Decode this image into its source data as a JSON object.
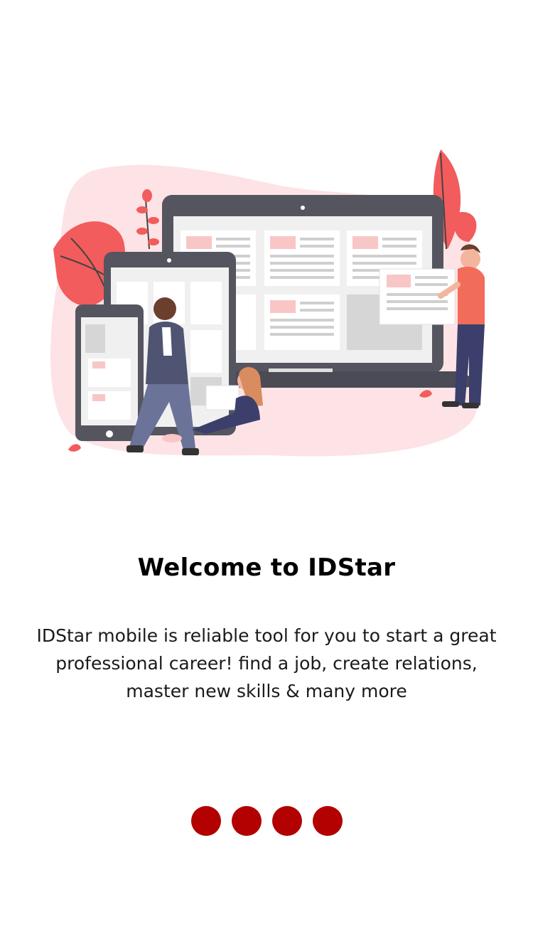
{
  "onboarding": {
    "title": "Welcome to IDStar",
    "description": "IDStar mobile is reliable tool for you to start a great professional career! find a job, create relations, master new skills & many more",
    "illustration_icon": "devices-people-illustration",
    "page_indicator": {
      "total": 4,
      "dot_color": "#b30000"
    }
  },
  "colors": {
    "accent": "#b30000",
    "illustration_red": "#f25c5c",
    "illustration_pink": "#fde3e5",
    "device_frame": "#555560"
  }
}
